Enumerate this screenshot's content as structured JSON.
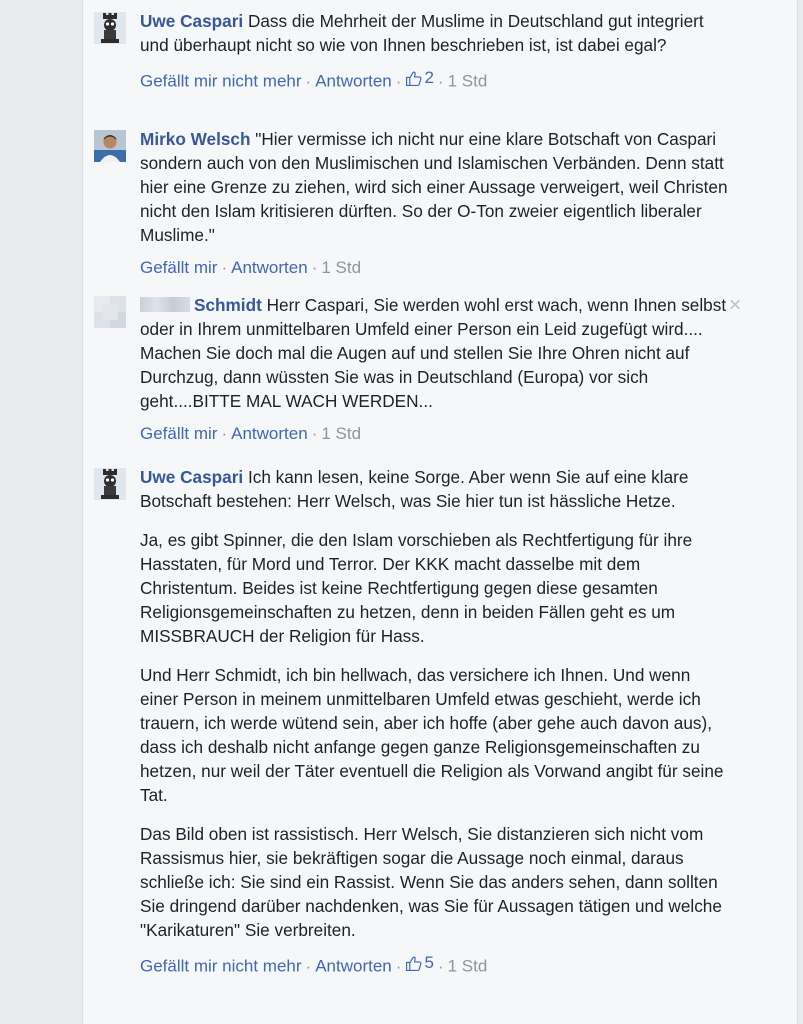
{
  "comments": [
    {
      "author": "Uwe Caspari",
      "paragraphs": [
        "Dass die Mehrheit der Muslime in Deutschland gut integriert und überhaupt nicht so wie von Ihnen beschrieben ist, ist dabei egal?"
      ],
      "like_label": "Gefällt mir nicht mehr",
      "reply_label": "Antworten",
      "like_count": "2",
      "time": "1 Std"
    },
    {
      "author": "Mirko Welsch",
      "paragraphs": [
        "\"Hier vermisse ich nicht nur eine klare Botschaft von Caspari sondern auch von den Muslimischen und Islamischen Verbänden. Denn statt hier eine Grenze zu ziehen, wird sich einer Aussage verweigert, weil Christen nicht den Islam kritisieren dürften. So der O-Ton zweier eigentlich liberaler Muslime.\""
      ],
      "like_label": "Gefällt mir",
      "reply_label": "Antworten",
      "time": "1 Std"
    },
    {
      "author": "Schmidt",
      "paragraphs": [
        "Herr Caspari, Sie werden wohl erst wach, wenn Ihnen selbst oder in Ihrem unmittelbaren Umfeld einer Person ein Leid zugefügt wird.... Machen Sie doch mal die Augen auf und stellen Sie Ihre Ohren nicht auf Durchzug, dann wüssten Sie was in Deutschland (Europa) vor sich geht....BITTE MAL WACH WERDEN..."
      ],
      "like_label": "Gefällt mir",
      "reply_label": "Antworten",
      "time": "1 Std"
    },
    {
      "author": "Uwe Caspari",
      "paragraphs": [
        "Ich kann lesen, keine Sorge. Aber wenn Sie auf eine klare Botschaft bestehen: Herr Welsch, was Sie hier tun ist hässliche Hetze.",
        "Ja, es gibt Spinner, die den Islam vorschieben als Rechtfertigung für ihre Hasstaten, für Mord und Terror. Der KKK macht dasselbe mit dem Christentum. Beides ist keine Rechtfertigung gegen diese gesamten Religionsgemeinschaften zu hetzen, denn in beiden Fällen geht es um MISSBRAUCH der Religion für Hass.",
        "Und Herr Schmidt, ich bin hellwach, das versichere ich Ihnen. Und wenn einer Person in meinem unmittelbaren Umfeld etwas geschieht, werde ich trauern, ich werde wütend sein, aber ich hoffe (aber gehe auch davon aus), dass ich deshalb nicht anfange gegen ganze Religionsgemeinschaften zu hetzen, nur weil der Täter eventuell die Religion als Vorwand angibt für seine Tat.",
        "Das Bild oben ist rassistisch. Herr Welsch, Sie distanzieren sich nicht vom Rassismus hier, sie bekräftigen sogar die Aussage noch einmal, daraus schließe ich: Sie sind ein Rassist. Wenn Sie das anders sehen, dann sollten Sie dringend darüber nachdenken, was Sie für Aussagen tätigen und welche \"Karikaturen\" Sie verbreiten."
      ],
      "like_label": "Gefällt mir nicht mehr",
      "reply_label": "Antworten",
      "like_count": "5",
      "time": "1 Std"
    }
  ],
  "separator": "·",
  "close_symbol": "×",
  "colors": {
    "link": "#4267b2",
    "author": "#365899",
    "meta": "#90949c"
  }
}
